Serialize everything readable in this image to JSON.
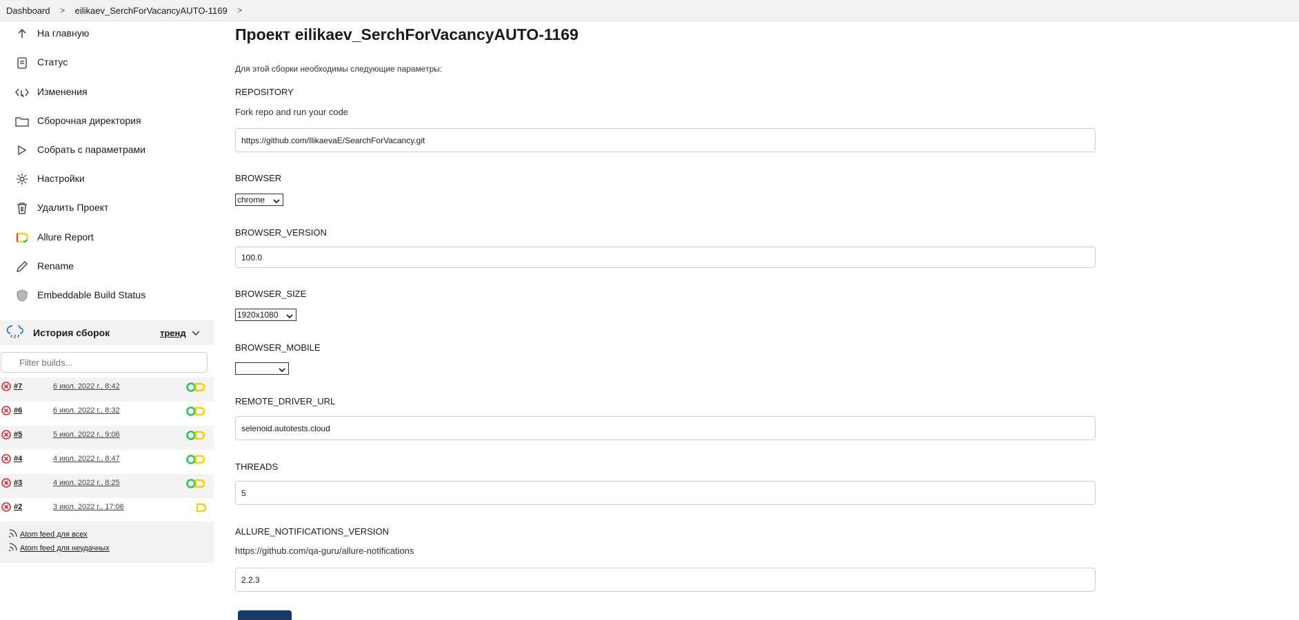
{
  "breadcrumb": {
    "items": [
      "Dashboard",
      "eilikaev_SerchForVacancyAUTO-1169"
    ]
  },
  "sidebar": {
    "tasks": [
      {
        "label": "На главную",
        "icon": "arrow-up-icon"
      },
      {
        "label": "Статус",
        "icon": "document-icon"
      },
      {
        "label": "Изменения",
        "icon": "code-changes-icon"
      },
      {
        "label": "Сборочная директория",
        "icon": "folder-icon"
      },
      {
        "label": "Собрать с параметрами",
        "icon": "play-icon"
      },
      {
        "label": "Настройки",
        "icon": "gear-icon"
      },
      {
        "label": "Удалить Проект",
        "icon": "trash-icon"
      },
      {
        "label": "Allure Report",
        "icon": "allure-icon"
      },
      {
        "label": "Rename",
        "icon": "pencil-icon"
      },
      {
        "label": "Embeddable Build Status",
        "icon": "shield-icon"
      }
    ]
  },
  "history": {
    "title": "История сборок",
    "trend_label": "тренд",
    "filter_placeholder": "Filter builds...",
    "builds": [
      {
        "number": "#7",
        "date": "6 июл. 2022 г., 8:42",
        "status": "failed"
      },
      {
        "number": "#6",
        "date": "6 июл. 2022 г., 8:32",
        "status": "failed"
      },
      {
        "number": "#5",
        "date": "5 июл. 2022 г., 9:06",
        "status": "failed"
      },
      {
        "number": "#4",
        "date": "4 июл. 2022 г., 8:47",
        "status": "failed"
      },
      {
        "number": "#3",
        "date": "4 июл. 2022 г., 8:25",
        "status": "failed"
      },
      {
        "number": "#2",
        "date": "3 июл. 2022 г., 17:06",
        "status": "failed"
      }
    ],
    "feeds": [
      "Atom feed для всех",
      "Atom feed для неудачных"
    ]
  },
  "main": {
    "title": "Проект eilikaev_SerchForVacancyAUTO-1169",
    "intro": "Для этой сборки необходимы следующие параметры:",
    "params": {
      "repository": {
        "name": "REPOSITORY",
        "description": "Fork repo and run your code",
        "value": "https://github.com/IlikaevaE/SearchForVacancy.git"
      },
      "browser": {
        "name": "BROWSER",
        "value": "chrome"
      },
      "browser_version": {
        "name": "BROWSER_VERSION",
        "value": "100.0"
      },
      "browser_size": {
        "name": "BROWSER_SIZE",
        "value": "1920x1080"
      },
      "browser_mobile": {
        "name": "BROWSER_MOBILE",
        "value": ""
      },
      "remote_driver_url": {
        "name": "REMOTE_DRIVER_URL",
        "value": "selenoid.autotests.cloud"
      },
      "threads": {
        "name": "THREADS",
        "value": "5"
      },
      "allure_notifications_version": {
        "name": "ALLURE_NOTIFICATIONS_VERSION",
        "description": "https://github.com/qa-guru/allure-notifications",
        "value": "2.2.3"
      }
    }
  },
  "colors": {
    "fail_red": "#d62839",
    "success_green": "#22c55e",
    "allure_yellow": "#f5d20a",
    "build_button": "#143c64"
  }
}
